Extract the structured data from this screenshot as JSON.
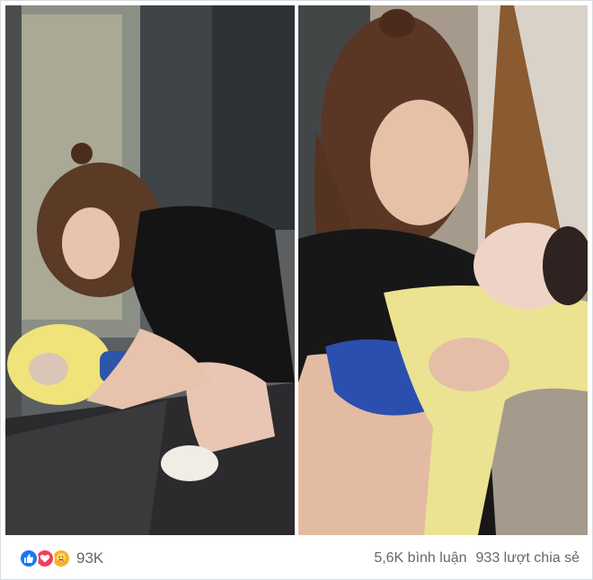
{
  "post": {
    "images": [
      {
        "alt": "woman-bending-over-baby-on-floor"
      },
      {
        "alt": "woman-holding-baby-closeup"
      }
    ]
  },
  "footer": {
    "reaction_icons": [
      "like-icon",
      "love-icon",
      "care-icon"
    ],
    "reaction_count": "93K",
    "comments": "5,6K bình luận",
    "shares": "933 lượt chia sẻ"
  },
  "colors": {
    "like": "#1877f2",
    "love": "#f33e58",
    "care": "#f7b125",
    "meta_text": "#65676b"
  }
}
